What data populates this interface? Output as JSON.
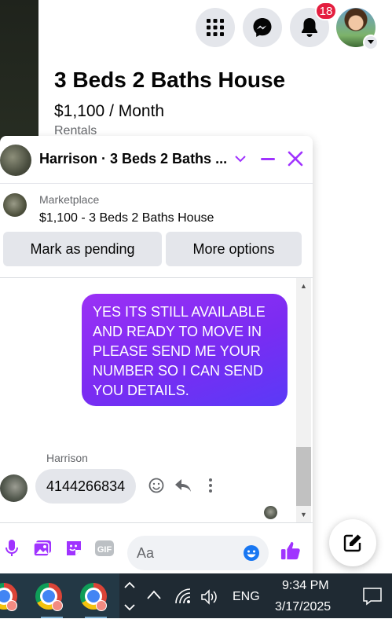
{
  "topbar": {
    "notification_count": "18",
    "icons": [
      "menu-grid-icon",
      "messenger-icon",
      "bell-icon"
    ]
  },
  "listing": {
    "title": "3 Beds 2 Baths House",
    "price": "$1,100 / Month",
    "category": "Rentals"
  },
  "chat": {
    "header_title": "Harrison · 3 Beds 2 Baths ...",
    "marketplace_label": "Marketplace",
    "marketplace_item": "$1,100 - 3 Beds 2 Baths House",
    "mark_pending_label": "Mark as pending",
    "more_options_label": "More options",
    "accent_color": "#a033ff",
    "messages": [
      {
        "from": "me",
        "text": "YES ITS STILL AVAILABLE\nAND READY TO MOVE IN\nPLEASE SEND ME YOUR\nNUMBER SO I CAN SEND\nYOU DETAILS."
      },
      {
        "from": "Harrison",
        "sender_name": "Harrison",
        "text": "4144266834"
      }
    ],
    "composer_placeholder": "Aa"
  },
  "taskbar": {
    "language": "ENG",
    "time": "9:34 PM",
    "date": "3/17/2025"
  }
}
